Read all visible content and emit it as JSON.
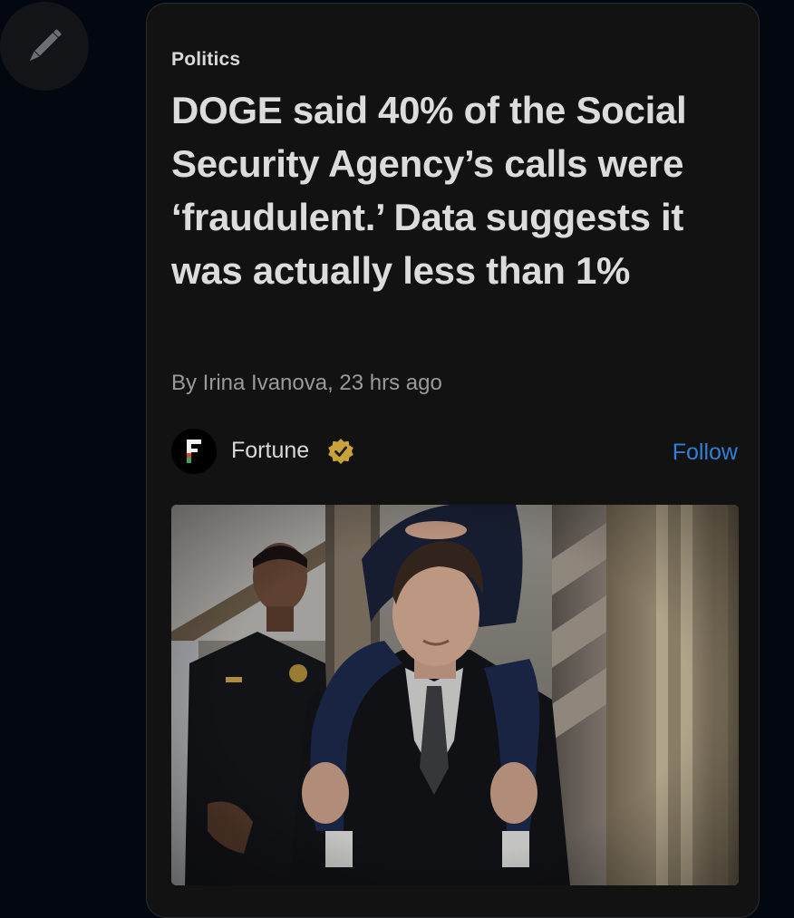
{
  "compose_button": {
    "icon": "pencil-icon"
  },
  "article": {
    "category": "Politics",
    "headline": "DOGE said 40% of the Social Security Agency’s calls were ‘fraudulent.’ Data suggests it was actually less than 1%",
    "byline": "By Irina Ivanova, 23 hrs ago",
    "source": {
      "name": "Fortune",
      "logo_letter": "F",
      "verified": true,
      "follow_label": "Follow"
    },
    "image": {
      "icon": "article-photo"
    }
  },
  "colors": {
    "background": "#03070f",
    "card": "#121212",
    "link": "#2f7fd9",
    "verified_badge": "#c8a23a"
  }
}
